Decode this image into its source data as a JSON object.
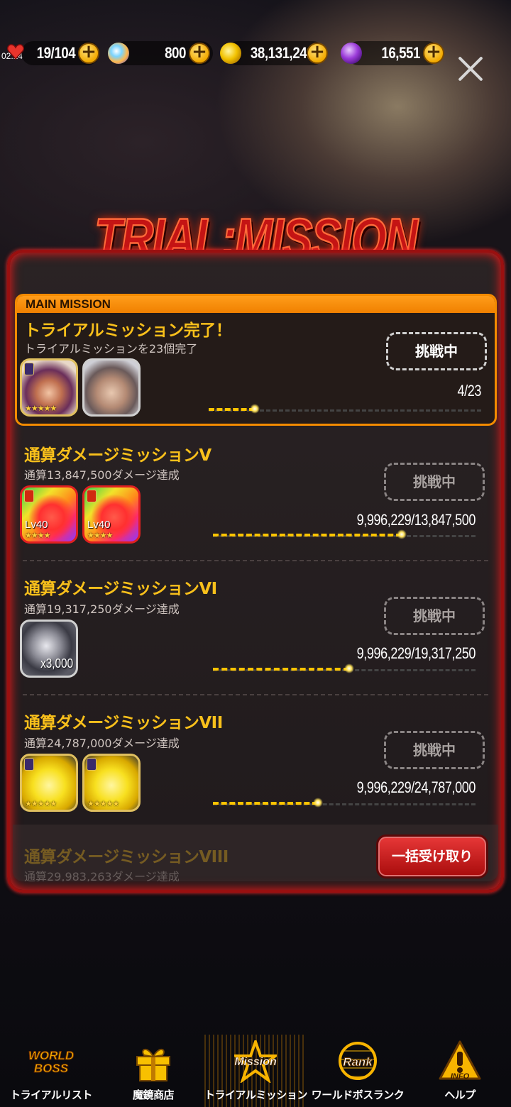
{
  "status_bar": {
    "time": "02:14"
  },
  "resources": {
    "stamina": {
      "icon": "heart-icon",
      "value": "19/104"
    },
    "gems": {
      "icon": "crystal-icon",
      "value": "800"
    },
    "gold": {
      "icon": "gold-coins-icon",
      "value": "38,131,243"
    },
    "purple": {
      "icon": "purple-gem-icon",
      "value": "16,551"
    }
  },
  "title_logo": "TRIAL:MISSION",
  "main_mission": {
    "header": "MAIN MISSION",
    "title": "トライアルミッション完了！",
    "description": "トライアルミッションを23個完了",
    "status": "挑戦中",
    "progress_text": "4/23",
    "progress": 0.17
  },
  "missions": [
    {
      "title": "通算ダメージミッションV",
      "description": "通算13,847,500ダメージ達成",
      "status": "挑戦中",
      "progress_text": "9,996,229/13,847,500",
      "progress": 0.72,
      "rewards": [
        {
          "type": "rainbow-slime",
          "level": "Lv40",
          "stars": "★★★★"
        },
        {
          "type": "rainbow-slime",
          "level": "Lv40",
          "stars": "★★★★"
        }
      ]
    },
    {
      "title": "通算ダメージミッションVI",
      "description": "通算19,317,250ダメージ達成",
      "status": "挑戦中",
      "progress_text": "9,996,229/19,317,250",
      "progress": 0.52,
      "rewards": [
        {
          "type": "silver-coin",
          "quantity": "x3,000"
        }
      ]
    },
    {
      "title": "通算ダメージミッションVII",
      "description": "通算24,787,000ダメージ達成",
      "status": "挑戦中",
      "progress_text": "9,996,229/24,787,000",
      "progress": 0.4,
      "rewards": [
        {
          "type": "yellow-slime",
          "stars": "★★★★★"
        },
        {
          "type": "yellow-slime",
          "stars": "★★★★★"
        }
      ]
    },
    {
      "title": "通算ダメージミッションVIII",
      "description": "通算29,983,263ダメージ達成"
    }
  ],
  "main_rewards": [
    {
      "type": "character-girl",
      "stars": "★★★★★"
    },
    {
      "type": "character-girl-2"
    }
  ],
  "claim_all_label": "一括受け取り",
  "nav": [
    {
      "label": "トライアルリスト",
      "icon": "world-boss-icon",
      "icon_text": "WORLD BOSS"
    },
    {
      "label": "魔鏡商店",
      "icon": "gift-icon"
    },
    {
      "label": "トライアルミッション",
      "icon": "mission-star-icon",
      "icon_text": "Mission"
    },
    {
      "label": "ワールドボスランク",
      "icon": "rank-globe-icon",
      "icon_text": "Rank"
    },
    {
      "label": "ヘルプ",
      "icon": "info-icon",
      "icon_text": "INFO"
    }
  ],
  "colors": {
    "accent": "#f9c01b",
    "frame": "#9a1010",
    "main_border": "#f38b00",
    "progress": "#ffc400"
  }
}
